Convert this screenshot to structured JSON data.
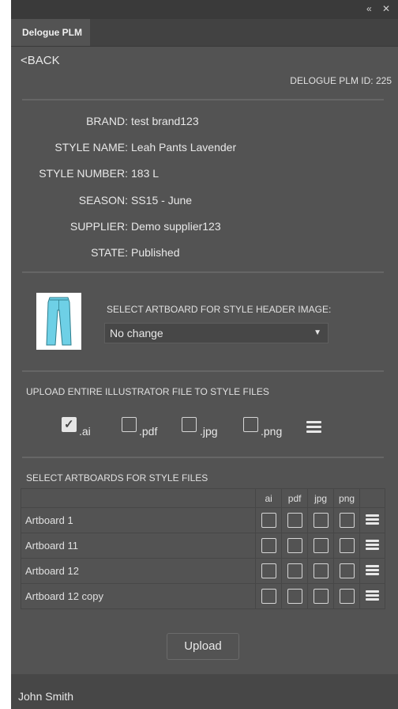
{
  "window": {
    "collapse_glyph": "«",
    "close_glyph": "✕"
  },
  "tab": {
    "label": "Delogue PLM"
  },
  "back_label": "<BACK",
  "plm_id_label": "DELOGUE PLM ID: 225",
  "style_info": [
    {
      "label": "BRAND:",
      "value": "test brand123"
    },
    {
      "label": "STYLE NAME:",
      "value": "Leah Pants Lavender"
    },
    {
      "label": "STYLE NUMBER:",
      "value": "183 L"
    },
    {
      "label": "SEASON:",
      "value": "SS15 - June"
    },
    {
      "label": "SUPPLIER:",
      "value": "Demo supplier123"
    },
    {
      "label": "STATE:",
      "value": "Published"
    }
  ],
  "header_image": {
    "label": "SELECT ARTBOARD FOR STYLE HEADER IMAGE:",
    "selected": "No change",
    "thumbnail_color": "#6ed0e6"
  },
  "illustrator_upload": {
    "label": "UPLOAD ENTIRE ILLUSTRATOR FILE TO STYLE FILES",
    "formats": [
      {
        "label": ".ai",
        "checked": true
      },
      {
        "label": ".pdf",
        "checked": false
      },
      {
        "label": ".jpg",
        "checked": false
      },
      {
        "label": ".png",
        "checked": false
      }
    ]
  },
  "artboards": {
    "label": "SELECT ARTBOARDS FOR STYLE FILES",
    "columns": [
      "ai",
      "pdf",
      "jpg",
      "png"
    ],
    "rows": [
      {
        "name": "Artboard 1"
      },
      {
        "name": "Artboard 11"
      },
      {
        "name": "Artboard 12"
      },
      {
        "name": "Artboard 12 copy"
      }
    ]
  },
  "upload_button": "Upload",
  "user_name": "John Smith",
  "colors": {
    "panel_bg": "#535353",
    "accent_text": "#e8e8e8"
  }
}
